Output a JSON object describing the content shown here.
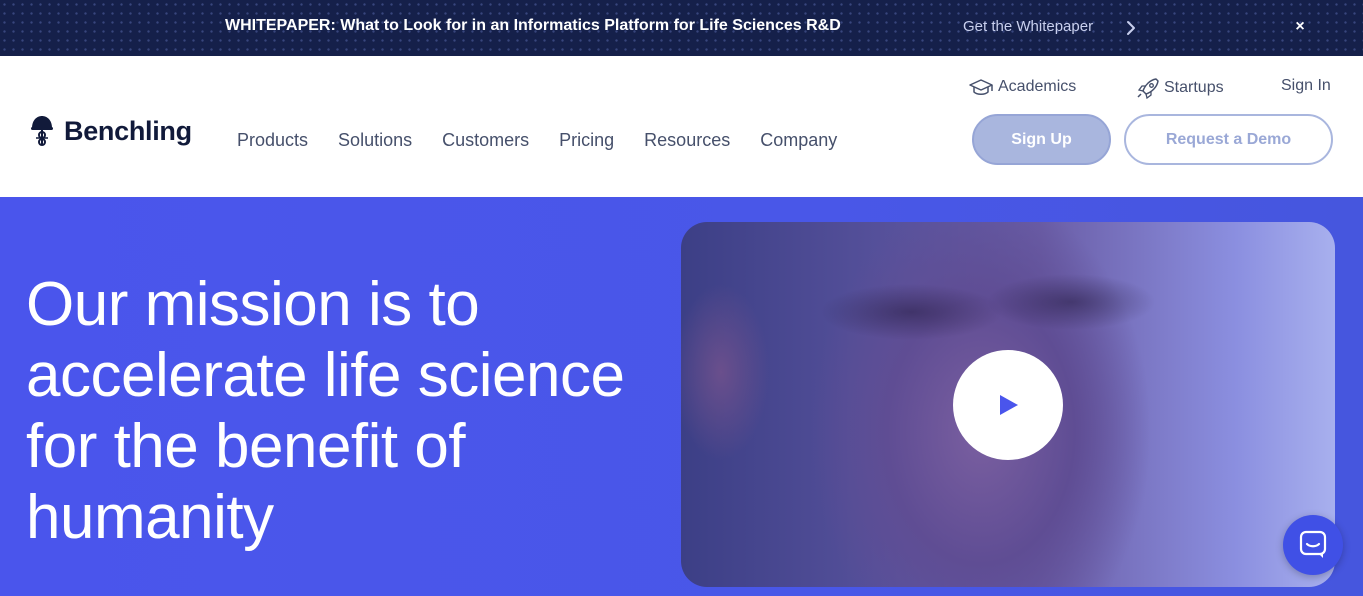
{
  "banner": {
    "text": "WHITEPAPER: What to Look for in an Informatics Platform for Life Sciences R&D",
    "cta_label": "Get the Whitepaper",
    "close_label": "×"
  },
  "header": {
    "logo_text": "Benchling",
    "nav": [
      "Products",
      "Solutions",
      "Customers",
      "Pricing",
      "Resources",
      "Company"
    ],
    "utility": {
      "academics": "Academics",
      "startups": "Startups",
      "sign_in": "Sign In"
    },
    "signup_label": "Sign Up",
    "demo_label": "Request a Demo"
  },
  "hero": {
    "title_lines": [
      "Our mission is to",
      "accelerate life science",
      "for the benefit of",
      "humanity"
    ]
  },
  "colors": {
    "banner_bg": "#15204a",
    "hero_bg": "#4a55ec",
    "brand_dark": "#111a3a",
    "signup_bg": "#a9b6de",
    "chat_bg": "#4050e6"
  },
  "icons": [
    "benchling-logo-icon",
    "chevron-right-icon",
    "close-icon",
    "graduation-cap-icon",
    "rocket-icon",
    "play-icon",
    "chat-icon"
  ]
}
